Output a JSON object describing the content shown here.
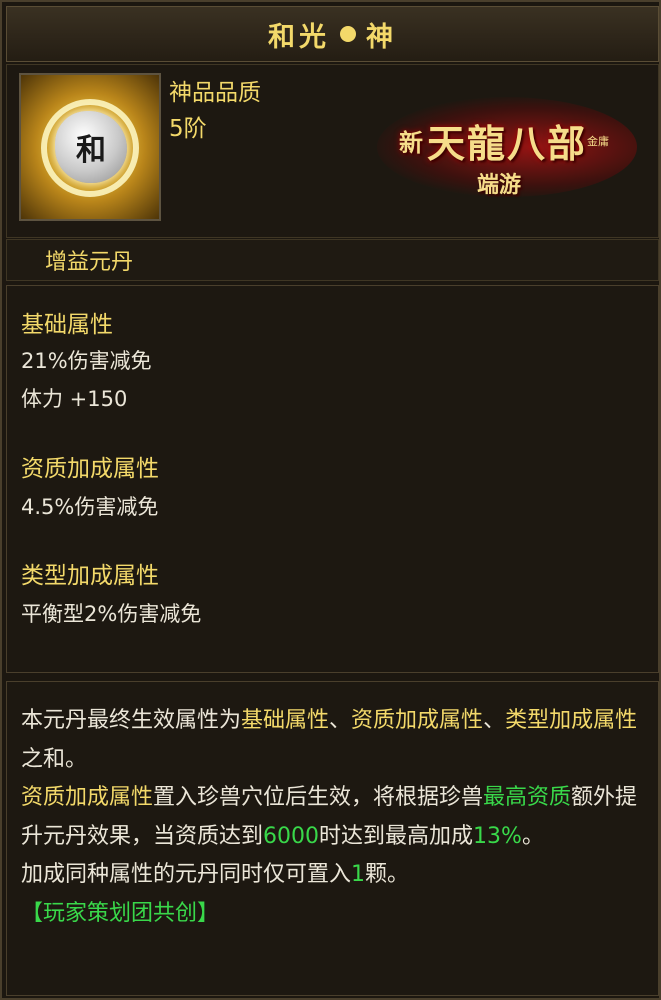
{
  "title": {
    "left": "和光",
    "right": "神"
  },
  "item": {
    "icon_glyph": "和",
    "quality": "神品品质",
    "level": "5阶",
    "type": "增益元丹"
  },
  "logo": {
    "new": "新",
    "main": "天龍八部",
    "sub": "端游",
    "small": "金庸"
  },
  "attributes": {
    "base_heading": "基础属性",
    "base_lines": [
      "21%伤害减免",
      "体力 +150"
    ],
    "aptitude_heading": "资质加成属性",
    "aptitude_lines": [
      "4.5%伤害减免"
    ],
    "type_heading": "类型加成属性",
    "type_lines": [
      "平衡型2%伤害减免"
    ]
  },
  "description": {
    "p1_a": "本元丹最终生效属性为",
    "p1_b": "基础属性",
    "p1_c": "、",
    "p1_d": "资质加成属性",
    "p1_e": "、",
    "p1_f": "类型加成属性",
    "p1_g": "之和。",
    "p2_a": "资质加成属性",
    "p2_b": "置入珍兽穴位后生效，将根据珍兽",
    "p2_c": "最高资质",
    "p2_d": "额外提升元丹效果，当资质达到",
    "p2_e": "6000",
    "p2_f": "时达到最高加成",
    "p2_g": "13%",
    "p2_h": "。",
    "p3_a": "加成同种属性的元丹同时仅可置入",
    "p3_b": "1",
    "p3_c": "颗。",
    "credit": "【玩家策划团共创】"
  },
  "colors": {
    "title_gold": "#f3d96a",
    "highlight_green": "#39d84a",
    "panel_bg": "#1d1811"
  }
}
